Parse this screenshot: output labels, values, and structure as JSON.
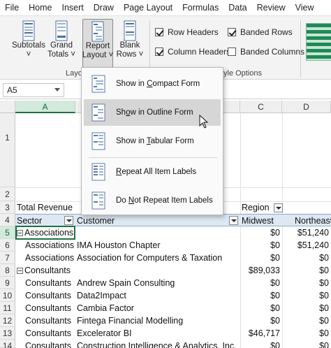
{
  "tabs": [
    "File",
    "Home",
    "Insert",
    "Draw",
    "Page Layout",
    "Formulas",
    "Data",
    "Review",
    "View"
  ],
  "ribbon": {
    "subtotals_label": [
      "Subtotals",
      "˅"
    ],
    "grand_totals_label": [
      "Grand",
      "Totals ˅"
    ],
    "report_layout_label": [
      "Report",
      "Layout ˅"
    ],
    "blank_rows_label": [
      "Blank",
      "Rows ˅"
    ],
    "layout_group_label": "Layou",
    "style_options_group_label": "yle Options",
    "checkboxes": [
      {
        "label": "Row Headers",
        "checked": true
      },
      {
        "label": "Banded Rows",
        "checked": true
      },
      {
        "label": "Column Headers",
        "checked": true
      },
      {
        "label": "Banded Columns",
        "checked": false
      }
    ]
  },
  "formula_bar": {
    "name_box": "A5"
  },
  "columns": [
    "A",
    "C",
    "D"
  ],
  "rows": [
    "1",
    "2",
    "3",
    "4",
    "5",
    "6",
    "7",
    "8",
    "9",
    "10",
    "11",
    "12",
    "13",
    "14"
  ],
  "menu": {
    "items": [
      {
        "pre": "Show in ",
        "ul": "C",
        "post": "ompact Form"
      },
      {
        "pre": "Sh",
        "ul": "o",
        "post": "w in Outline Form"
      },
      {
        "pre": "Show in ",
        "ul": "T",
        "post": "abular Form"
      },
      {
        "pre": "",
        "ul": "R",
        "post": "epeat All Item Labels"
      },
      {
        "pre": "Do ",
        "ul": "N",
        "post": "ot Repeat Item Labels"
      }
    ]
  },
  "sheet": {
    "row3": {
      "a": "Total Revenue",
      "c": "Region"
    },
    "row4": {
      "a": "Sector",
      "b": "Customer",
      "c": "Midwest",
      "d": "Northeast"
    },
    "data": [
      {
        "a": "Associations",
        "b": "",
        "c": "",
        "d": "",
        "group": true
      },
      {
        "a": "Associations",
        "b": "IMA Houston Chapter",
        "c": "$0",
        "d": "$51,240"
      },
      {
        "a": "Associations",
        "b": "Association for Computers & Taxation",
        "c": "$0",
        "d": "$0"
      },
      {
        "a": "Consultants",
        "b": "",
        "c": "$89,033",
        "d": "$0",
        "group": true
      },
      {
        "a": "Consultants",
        "b": "Andrew Spain Consulting",
        "c": "$0",
        "d": "$0"
      },
      {
        "a": "Consultants",
        "b": "Data2Impact",
        "c": "$0",
        "d": "$0"
      },
      {
        "a": "Consultants",
        "b": "Cambia Factor",
        "c": "$0",
        "d": "$0"
      },
      {
        "a": "Consultants",
        "b": "Fintega Financial Modelling",
        "c": "$0",
        "d": "$0"
      },
      {
        "a": "Consultants",
        "b": "Excelerator BI",
        "c": "$46,717",
        "d": "$0"
      },
      {
        "a": "Consultants",
        "b": "Construction Intelligence & Analytics, Inc.",
        "c": "$0",
        "d": "$0"
      }
    ],
    "group_totals": {
      "row5": {
        "c": "$0",
        "d": "$51,240"
      }
    }
  },
  "colors": {
    "accent": "#1e7145",
    "header_fill": "#dde8f3",
    "menu_hover": "#d6d6d6"
  }
}
